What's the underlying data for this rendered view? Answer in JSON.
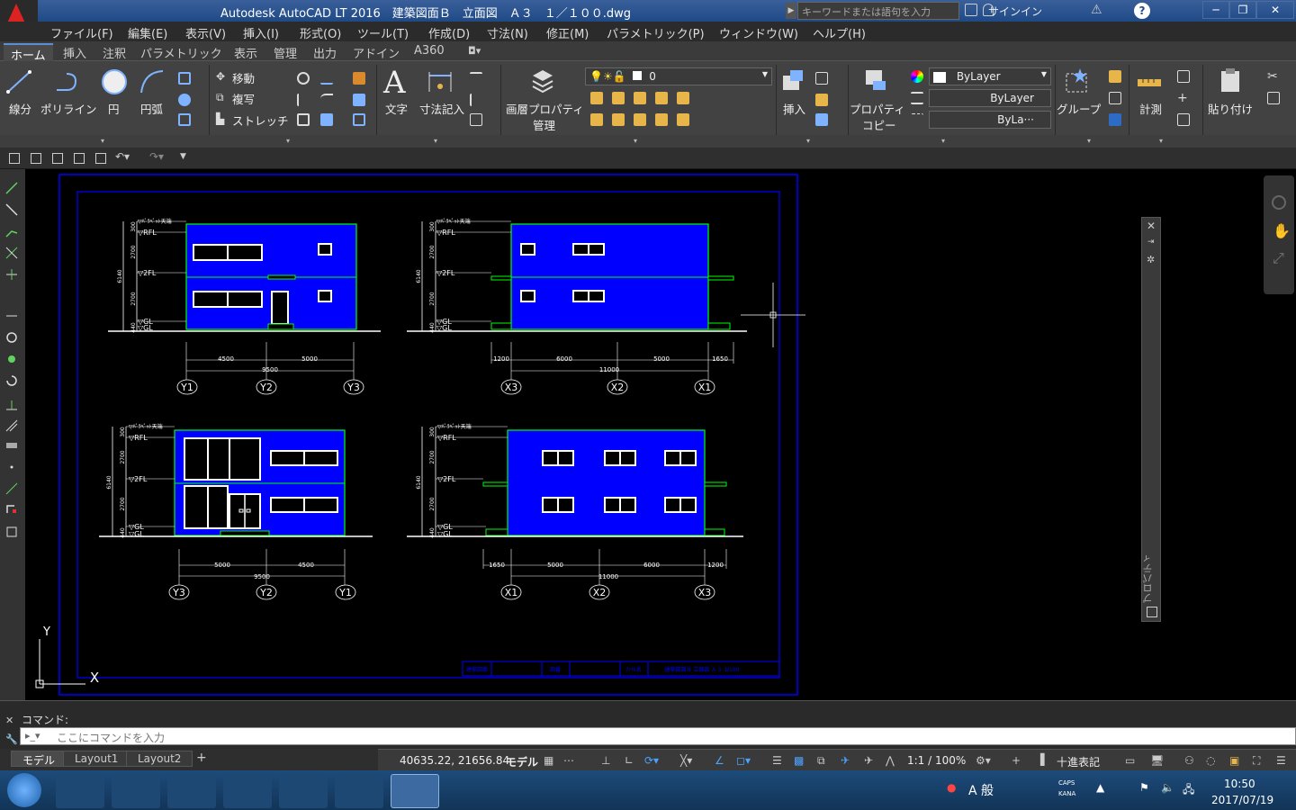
{
  "window": {
    "title": "Autodesk AutoCAD LT 2016　建築図面Ｂ　立面図　Ａ３　１／１００.dwg",
    "logo_text": "LT",
    "search_placeholder": "キーワードまたは語句を入力",
    "signin": "サインイン",
    "min_icon": "minimize-icon",
    "max_icon": "maximize-icon",
    "close_icon": "close-icon"
  },
  "menu": [
    "ファイル(F)",
    "編集(E)",
    "表示(V)",
    "挿入(I)",
    "形式(O)",
    "ツール(T)",
    "作成(D)",
    "寸法(N)",
    "修正(M)",
    "パラメトリック(P)",
    "ウィンドウ(W)",
    "ヘルプ(H)"
  ],
  "ribbon_tabs": [
    "ホーム",
    "挿入",
    "注釈",
    "パラメトリック",
    "表示",
    "管理",
    "出力",
    "アドイン",
    "A360"
  ],
  "ribbon": {
    "draw": {
      "line": "線分",
      "polyline": "ポリライン",
      "circle": "円",
      "arc": "円弧"
    },
    "modify": {
      "move": "移動",
      "copy": "複写",
      "stretch": "ストレッチ"
    },
    "annotation": {
      "text": "文字",
      "dimension": "寸法記入"
    },
    "layers": {
      "layer_properties_1": "画層プロパティ",
      "layer_properties_2": "管理",
      "current_layer": "0"
    },
    "block": {
      "insert": "挿入"
    },
    "properties": {
      "match_1": "プロパティ",
      "match_2": "コピー",
      "color": "ByLayer",
      "linetype": "ByLayer",
      "lineweight": "ByLa···"
    },
    "groups": {
      "group": "グループ"
    },
    "utilities": {
      "measure": "計測"
    },
    "clipboard": {
      "paste": "貼り付け"
    }
  },
  "drawing": {
    "ucs_y": "Y",
    "ucs_x": "X",
    "elevations": [
      {
        "levels": {
          "top": "▽ﾊﾟﾗﾍﾟｯﾄ天端",
          "rfl": "▽RFL",
          "2fl": "▽2FL",
          "gl1": "▽GL",
          "gl2": "▽GL"
        },
        "vdims": {
          "total": "6140",
          "upper": "2700",
          "lower": "2700",
          "top": "300",
          "base": "440"
        },
        "hdims": [
          "4500",
          "5000"
        ],
        "hdim_total": "9500",
        "axes": [
          "Y1",
          "Y2",
          "Y3"
        ]
      },
      {
        "levels": {
          "top": "▽ﾊﾟﾗﾍﾟｯﾄ天端",
          "rfl": "▽RFL",
          "2fl": "▽2FL",
          "gl1": "▽GL",
          "gl2": "▽GL"
        },
        "vdims": {
          "total": "6140",
          "upper": "2700",
          "lower": "2700",
          "top": "300",
          "base": "440"
        },
        "hdims": [
          "1200",
          "6000",
          "5000",
          "1650"
        ],
        "hdim_total": "11000",
        "axes": [
          "X3",
          "X2",
          "X1"
        ]
      },
      {
        "levels": {
          "top": "▽ﾊﾟﾗﾍﾟｯﾄ天端",
          "rfl": "▽RFL",
          "2fl": "▽2FL",
          "gl1": "▽GL",
          "gl2": "▽GL"
        },
        "vdims": {
          "total": "6140",
          "upper": "2700",
          "lower": "2700",
          "top": "300",
          "base": "440"
        },
        "hdims": [
          "5000",
          "4500"
        ],
        "hdim_total": "9500",
        "axes": [
          "Y3",
          "Y2",
          "Y1"
        ]
      },
      {
        "levels": {
          "top": "▽ﾊﾟﾗﾍﾟｯﾄ天端",
          "rfl": "▽RFL",
          "2fl": "▽2FL",
          "gl1": "▽GL",
          "gl2": "▽GL"
        },
        "vdims": {
          "total": "6140",
          "upper": "2700",
          "lower": "2700",
          "top": "300",
          "base": "440"
        },
        "hdims": [
          "1650",
          "5000",
          "6000",
          "1200"
        ],
        "hdim_total": "11000",
        "axes": [
          "X1",
          "X2",
          "X3"
        ]
      }
    ],
    "title_block": [
      "建築図面",
      "図番",
      "ﾌｧｲﾙ名",
      "建築図面Ｂ 立面図 Ａ３ 1/100"
    ]
  },
  "properties_palette": {
    "title": "プロパティ"
  },
  "command": {
    "label": "コマンド:",
    "placeholder": "ここにコマンドを入力"
  },
  "layout_tabs": [
    "モデル",
    "Layout1",
    "Layout2"
  ],
  "status": {
    "coords": "40635.22, 21656.84",
    "model": "モデル",
    "scale": "1:1 / 100%",
    "units": "十進表記"
  },
  "taskbar": {
    "time": "10:50",
    "date": "2017/07/19",
    "ime": "A 般",
    "caps": "CAPS",
    "kana": "KANA"
  },
  "colors": {
    "facade_fill": "#0000ff",
    "outline": "#00ff00",
    "frame": "#0000ff",
    "text": "#ffffff"
  }
}
